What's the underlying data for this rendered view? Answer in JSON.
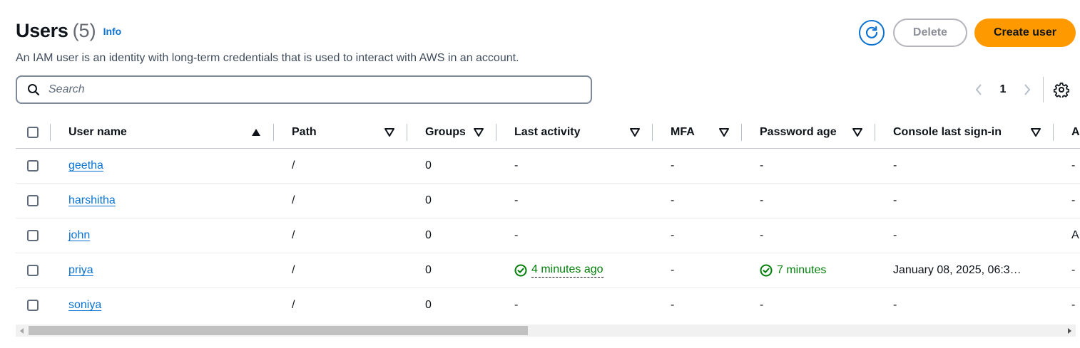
{
  "header": {
    "title": "Users",
    "count": "(5)",
    "info": "Info",
    "description": "An IAM user is an identity with long-term credentials that is used to interact with AWS in an account."
  },
  "actions": {
    "delete": "Delete",
    "create": "Create user"
  },
  "search": {
    "placeholder": "Search"
  },
  "pagination": {
    "page": "1"
  },
  "columns": [
    "User name",
    "Path",
    "Groups",
    "Last activity",
    "MFA",
    "Password age",
    "Console last sign-in",
    "A"
  ],
  "rows": [
    {
      "name": "geetha",
      "path": "/",
      "groups": "0",
      "last_activity": "-",
      "mfa": "-",
      "password_age": "-",
      "console": "-",
      "extra": "-"
    },
    {
      "name": "harshitha",
      "path": "/",
      "groups": "0",
      "last_activity": "-",
      "mfa": "-",
      "password_age": "-",
      "console": "-",
      "extra": "-"
    },
    {
      "name": "john",
      "path": "/",
      "groups": "0",
      "last_activity": "-",
      "mfa": "-",
      "password_age": "-",
      "console": "-",
      "extra": "A"
    },
    {
      "name": "priya",
      "path": "/",
      "groups": "0",
      "last_activity": "4 minutes ago",
      "mfa": "-",
      "password_age": "7 minutes",
      "console": "January 08, 2025, 06:3…",
      "extra": "-"
    },
    {
      "name": "soniya",
      "path": "/",
      "groups": "0",
      "last_activity": "-",
      "mfa": "-",
      "password_age": "-",
      "console": "-",
      "extra": "-"
    }
  ],
  "colors": {
    "accent": "#0972d3",
    "primary_button": "#ff9900",
    "success": "#037f0c"
  }
}
